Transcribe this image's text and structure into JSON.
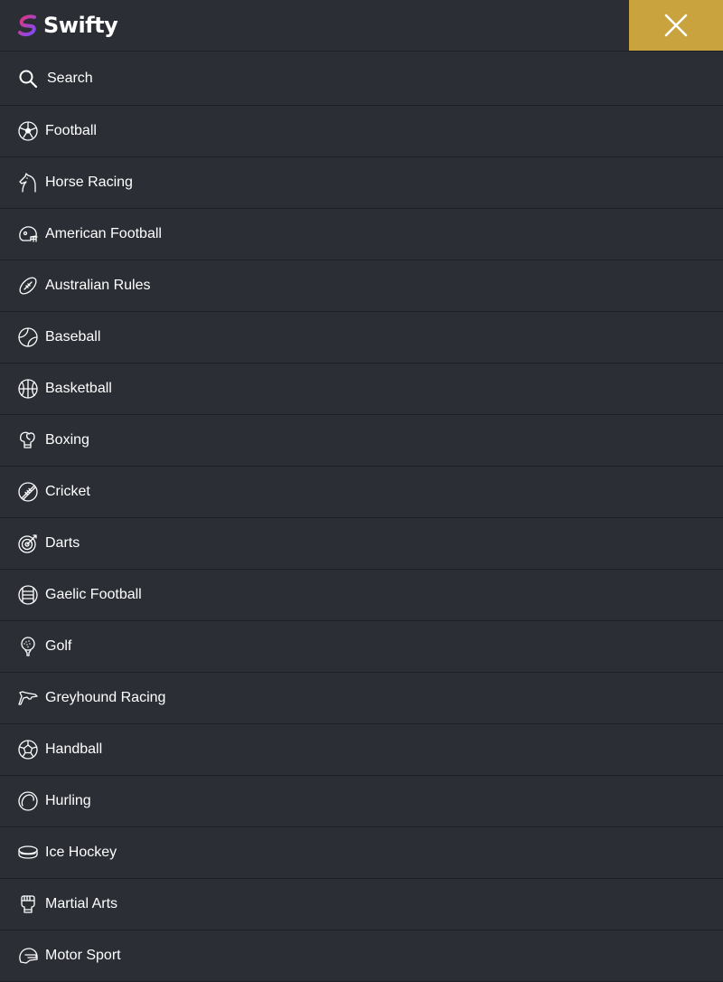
{
  "header": {
    "brand": "Swifty",
    "colors": {
      "accent": "#c9a43e",
      "background": "#2b2e35",
      "logo_gradient_start": "#e0357a",
      "logo_gradient_end": "#7b4dff"
    }
  },
  "close_button": {
    "icon": "close-icon"
  },
  "search": {
    "label": "Search",
    "icon": "search-icon"
  },
  "sports": [
    {
      "label": "Football",
      "icon": "football-icon"
    },
    {
      "label": "Horse Racing",
      "icon": "horse-icon"
    },
    {
      "label": "American Football",
      "icon": "helmet-icon"
    },
    {
      "label": "Australian Rules",
      "icon": "oval-ball-icon"
    },
    {
      "label": "Baseball",
      "icon": "baseball-icon"
    },
    {
      "label": "Basketball",
      "icon": "basketball-icon"
    },
    {
      "label": "Boxing",
      "icon": "boxing-glove-icon"
    },
    {
      "label": "Cricket",
      "icon": "cricket-ball-icon"
    },
    {
      "label": "Darts",
      "icon": "dartboard-icon"
    },
    {
      "label": "Gaelic Football",
      "icon": "gaelic-ball-icon"
    },
    {
      "label": "Golf",
      "icon": "golf-ball-icon"
    },
    {
      "label": "Greyhound Racing",
      "icon": "greyhound-icon"
    },
    {
      "label": "Handball",
      "icon": "handball-icon"
    },
    {
      "label": "Hurling",
      "icon": "sliotar-icon"
    },
    {
      "label": "Ice Hockey",
      "icon": "puck-icon"
    },
    {
      "label": "Martial Arts",
      "icon": "mma-glove-icon"
    },
    {
      "label": "Motor Sport",
      "icon": "racing-helmet-icon"
    }
  ]
}
